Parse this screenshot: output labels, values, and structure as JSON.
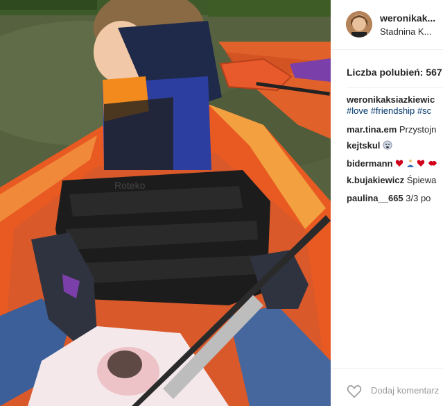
{
  "post": {
    "username": "weronikak...",
    "location": "Stadnina K...",
    "likes_text": "Liczba polubień: 567",
    "caption": {
      "author": "weronikaksiazkiewic",
      "hashtags": "#love #friendship #sc"
    },
    "comments": [
      {
        "author": "mar.tina.em",
        "text": " Przystojn"
      },
      {
        "author": "kejtskul",
        "text": ""
      },
      {
        "author": "bidermann",
        "text": ""
      },
      {
        "author": "k.bujakiewicz",
        "text": " Śpiewa"
      },
      {
        "author": "paulina__665",
        "text": " 3/3 po"
      }
    ],
    "add_comment_placeholder": "Dodaj komentarz"
  },
  "photo": {
    "seat_brand": "Roteko"
  },
  "icons": {
    "like": "heart-icon",
    "avatar": "avatar-photo"
  },
  "colors": {
    "hashtag": "#003569",
    "kayak": "#e8582a",
    "text": "#262626",
    "muted": "#999999"
  }
}
